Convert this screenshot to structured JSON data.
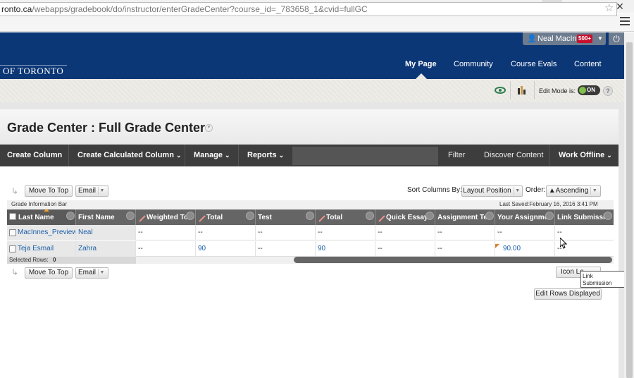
{
  "browser": {
    "url_domain": "ronto.ca",
    "url_path": "/webapps/gradebook/do/instructor/enterGradeCenter?course_id=_783658_1&cvid=fullGC"
  },
  "header": {
    "logo_text": "OF TORONTO",
    "user_name": "Neal MacInne",
    "notification_count": "500+",
    "nav": [
      "My Page",
      "Community",
      "Course Evals",
      "Content"
    ]
  },
  "toolstrip": {
    "edit_mode_label": "Edit Mode is:",
    "edit_mode_value": "ON",
    "help": "?"
  },
  "page": {
    "title": "Grade Center : Full Grade Center"
  },
  "action_bar": {
    "create_column": "Create Column",
    "create_calculated_column": "Create Calculated Column",
    "manage": "Manage",
    "reports": "Reports",
    "filter": "Filter",
    "discover_content": "Discover Content",
    "work_offline": "Work Offline"
  },
  "toolbar": {
    "move_to_top": "Move To Top",
    "email": "Email",
    "sort_columns_by_label": "Sort Columns By:",
    "sort_columns_by_value": "Layout Position",
    "order_label": "Order:",
    "order_value": "▲Ascending"
  },
  "grid": {
    "info_bar_label": "Grade Information Bar",
    "last_saved": "Last Saved:February 16, 2016 3:41 PM",
    "columns": [
      "Last Name",
      "First Name",
      "Weighted To",
      "Total",
      "Test",
      "Total",
      "Quick Essay",
      "Assignment Te",
      "Your Assignme",
      "Link Submissio"
    ],
    "rows": [
      [
        "MacInnes_PreviewU",
        "Neal",
        "--",
        "--",
        "--",
        "--",
        "--",
        "--",
        "--",
        "--"
      ],
      [
        "Teja Esmail",
        "Zahra",
        "--",
        "90",
        "--",
        "90",
        "--",
        "--",
        "90.00",
        "--"
      ]
    ],
    "selected_rows_label": "Selected Rows:",
    "selected_rows_count": "0"
  },
  "bottom": {
    "icon_legend": "Icon Le",
    "edit_rows_displayed": "Edit Rows Displayed",
    "tooltip": "Link Submission"
  }
}
